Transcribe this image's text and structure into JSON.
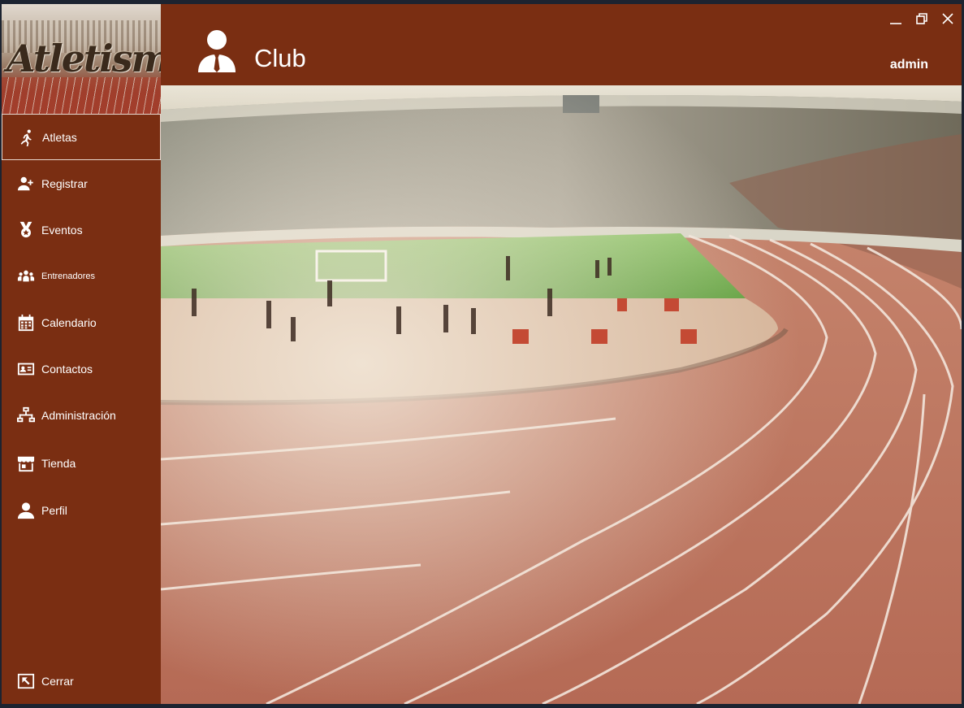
{
  "app": {
    "logo_text": "Atletismo",
    "title": "Club",
    "user": "admin"
  },
  "sidebar": {
    "items": [
      {
        "label": "Atletas",
        "icon": "running-person-icon",
        "active": true
      },
      {
        "label": "Registrar",
        "icon": "user-plus-icon"
      },
      {
        "label": "Eventos",
        "icon": "medal-icon"
      },
      {
        "label": "Entrenadores",
        "icon": "group-icon"
      },
      {
        "label": "Calendario",
        "icon": "calendar-icon"
      },
      {
        "label": "Contactos",
        "icon": "contact-card-icon"
      },
      {
        "label": "Administración",
        "icon": "network-icon"
      },
      {
        "label": "Tienda",
        "icon": "store-icon"
      },
      {
        "label": "Perfil",
        "icon": "user-icon"
      }
    ],
    "close": {
      "label": "Cerrar",
      "icon": "logout-icon"
    }
  },
  "colors": {
    "brand": "#7a2e12",
    "text": "#ffffff"
  }
}
